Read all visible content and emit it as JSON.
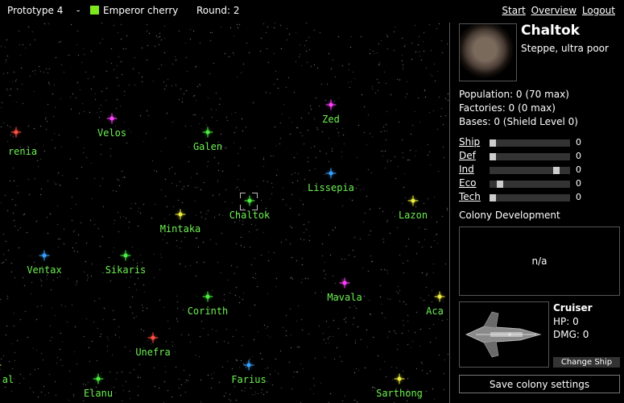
{
  "header": {
    "game_name": "Prototype 4",
    "separator": "-",
    "player_name": "Emperor cherry",
    "player_color": "#7ee81e",
    "round_label": "Round: 2",
    "links": {
      "start": "Start",
      "overview": "Overview",
      "logout": "Logout"
    }
  },
  "map": {
    "selected_system": "Chaltok",
    "systems": [
      {
        "name": "renia",
        "color": "#ff5040"
      },
      {
        "name": "Velos",
        "color": "#ff40ff"
      },
      {
        "name": "Galen",
        "color": "#4cf040"
      },
      {
        "name": "Zed",
        "color": "#ff40ff"
      },
      {
        "name": "Lissepia",
        "color": "#3aa0ff"
      },
      {
        "name": "Chaltok",
        "color": "#4cf040"
      },
      {
        "name": "Lazon",
        "color": "#f0f040"
      },
      {
        "name": "Mintaka",
        "color": "#f0f040"
      },
      {
        "name": "Ventax",
        "color": "#3aa0ff"
      },
      {
        "name": "Sikaris",
        "color": "#4cf040"
      },
      {
        "name": "Mavala",
        "color": "#ff40ff"
      },
      {
        "name": "Corinth",
        "color": "#4cf040"
      },
      {
        "name": "Aca",
        "color": "#f0f040"
      },
      {
        "name": "Unefra",
        "color": "#ff5040"
      },
      {
        "name": "al",
        "color": "#f0f040"
      },
      {
        "name": "Farius",
        "color": "#3aa0ff"
      },
      {
        "name": "Elanu",
        "color": "#4cf040"
      },
      {
        "name": "Sarthong",
        "color": "#f0f040"
      }
    ]
  },
  "planet": {
    "name": "Chaltok",
    "type": "Steppe, ultra poor",
    "population": "Population: 0 (70 max)",
    "factories": "Factories: 0 (0 max)",
    "bases": "Bases: 0 (Shield Level 0)"
  },
  "allocations": [
    {
      "label": "Ship",
      "value": "0",
      "level": 0.0
    },
    {
      "label": "Def",
      "value": "0",
      "level": 0.0
    },
    {
      "label": "Ind",
      "value": "0",
      "level": 0.86
    },
    {
      "label": "Eco",
      "value": "0",
      "level": 0.1
    },
    {
      "label": "Tech",
      "value": "0",
      "level": 0.0
    }
  ],
  "colony": {
    "heading": "Colony Development",
    "content": "n/a"
  },
  "ship": {
    "name": "Cruiser",
    "hp": "HP: 0",
    "dmg": "DMG: 0",
    "change_label": "Change Ship"
  },
  "save_label": "Save colony settings"
}
